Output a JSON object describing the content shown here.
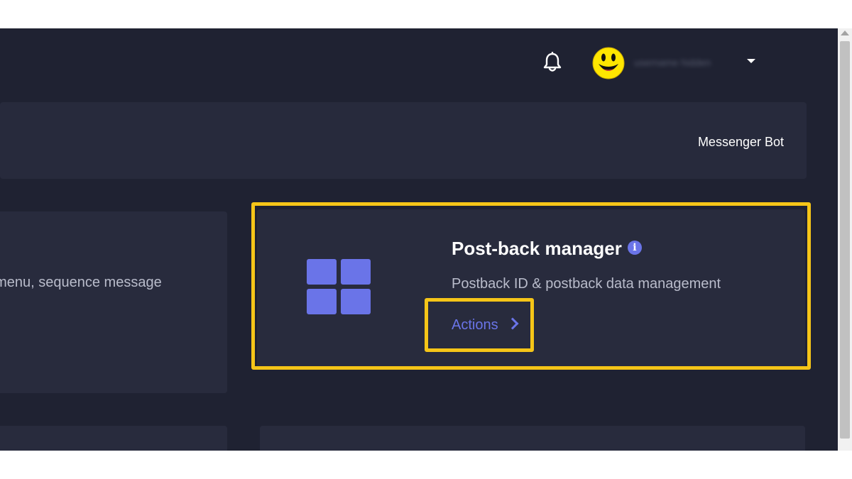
{
  "topbar": {
    "notification_icon": "bell-icon",
    "avatar_icon": "smiley-avatar-icon",
    "username": "username hidden",
    "menu_icon": "caret-down-icon"
  },
  "header": {
    "breadcrumb": "Messenger Bot"
  },
  "cards": {
    "left": {
      "title_fragment": "?",
      "description_fragment": "t menu, sequence message"
    },
    "main": {
      "icon": "grid-icon",
      "title": "Post-back manager",
      "info_icon": "info-icon",
      "description": "Postback ID & postback data management",
      "action_label": "Actions",
      "action_icon": "chevron-right-icon"
    }
  },
  "colors": {
    "background": "#1f2232",
    "card": "#282b3d",
    "accent": "#6a74e8",
    "highlight": "#f5c518"
  }
}
